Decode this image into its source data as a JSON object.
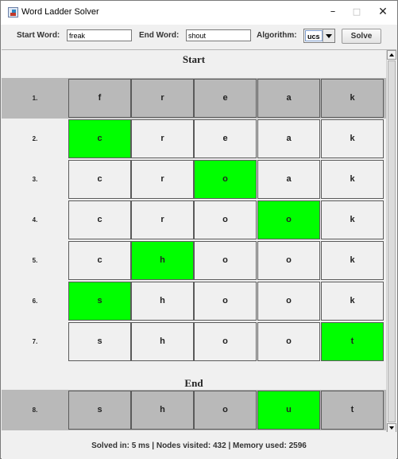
{
  "window": {
    "title": "Word Ladder Solver",
    "minimize": "–",
    "maximize": "□",
    "close": "✕"
  },
  "controls": {
    "start_label": "Start Word:",
    "start_value": "freak",
    "end_label": "End Word:",
    "end_value": "shout",
    "algorithm_label": "Algorithm:",
    "algorithm_value": "ucs",
    "solve_label": "Solve"
  },
  "ladder": {
    "start_heading": "Start",
    "end_heading": "End",
    "highlight_color": "#00ff00",
    "shaded_color": "#b9b9b9",
    "rows": [
      {
        "step": "1.",
        "letters": [
          "f",
          "r",
          "e",
          "a",
          "k"
        ],
        "highlight": -1,
        "shaded": true
      },
      {
        "step": "2.",
        "letters": [
          "c",
          "r",
          "e",
          "a",
          "k"
        ],
        "highlight": 0,
        "shaded": false
      },
      {
        "step": "3.",
        "letters": [
          "c",
          "r",
          "o",
          "a",
          "k"
        ],
        "highlight": 2,
        "shaded": false
      },
      {
        "step": "4.",
        "letters": [
          "c",
          "r",
          "o",
          "o",
          "k"
        ],
        "highlight": 3,
        "shaded": false
      },
      {
        "step": "5.",
        "letters": [
          "c",
          "h",
          "o",
          "o",
          "k"
        ],
        "highlight": 1,
        "shaded": false
      },
      {
        "step": "6.",
        "letters": [
          "s",
          "h",
          "o",
          "o",
          "k"
        ],
        "highlight": 0,
        "shaded": false
      },
      {
        "step": "7.",
        "letters": [
          "s",
          "h",
          "o",
          "o",
          "t"
        ],
        "highlight": 4,
        "shaded": false
      },
      {
        "step": "8.",
        "letters": [
          "s",
          "h",
          "o",
          "u",
          "t"
        ],
        "highlight": 3,
        "shaded": true
      }
    ]
  },
  "status": {
    "text": "Solved in: 5 ms  |  Nodes visited: 432  |  Memory used: 2596"
  },
  "icons": {
    "app": "java-app-icon",
    "scroll_up": "arrow-up-icon",
    "scroll_down": "arrow-down-icon",
    "dropdown": "chevron-down-icon"
  }
}
